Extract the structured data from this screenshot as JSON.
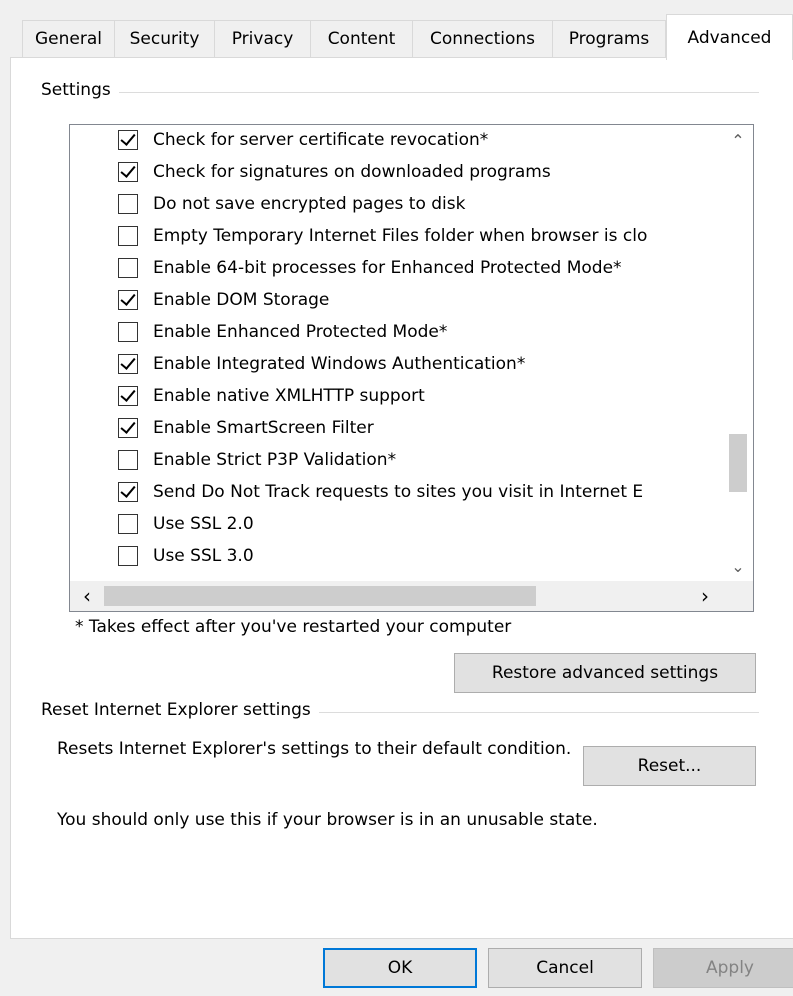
{
  "tabs": [
    {
      "label": "General",
      "active": false
    },
    {
      "label": "Security",
      "active": false
    },
    {
      "label": "Privacy",
      "active": false
    },
    {
      "label": "Content",
      "active": false
    },
    {
      "label": "Connections",
      "active": false
    },
    {
      "label": "Programs",
      "active": false
    },
    {
      "label": "Advanced",
      "active": true
    }
  ],
  "settings": {
    "title": "Settings",
    "items": [
      {
        "label": "Check for server certificate revocation*",
        "checked": true
      },
      {
        "label": "Check for signatures on downloaded programs",
        "checked": true
      },
      {
        "label": "Do not save encrypted pages to disk",
        "checked": false
      },
      {
        "label": "Empty Temporary Internet Files folder when browser is clo",
        "checked": false
      },
      {
        "label": "Enable 64-bit processes for Enhanced Protected Mode*",
        "checked": false
      },
      {
        "label": "Enable DOM Storage",
        "checked": true
      },
      {
        "label": "Enable Enhanced Protected Mode*",
        "checked": false
      },
      {
        "label": "Enable Integrated Windows Authentication*",
        "checked": true
      },
      {
        "label": "Enable native XMLHTTP support",
        "checked": true
      },
      {
        "label": "Enable SmartScreen Filter",
        "checked": true
      },
      {
        "label": "Enable Strict P3P Validation*",
        "checked": false
      },
      {
        "label": "Send Do Not Track requests to sites you visit in Internet E",
        "checked": true
      },
      {
        "label": "Use SSL 2.0",
        "checked": false
      },
      {
        "label": "Use SSL 3.0",
        "checked": false
      }
    ],
    "note": "* Takes effect after you've restarted your computer",
    "restore_button": "Restore advanced settings"
  },
  "reset": {
    "title": "Reset Internet Explorer settings",
    "description": "Resets Internet Explorer's settings to their default condition.",
    "reset_button": "Reset...",
    "warning": "You should only use this if your browser is in an unusable state."
  },
  "footer": {
    "ok": "OK",
    "cancel": "Cancel",
    "apply": "Apply"
  }
}
